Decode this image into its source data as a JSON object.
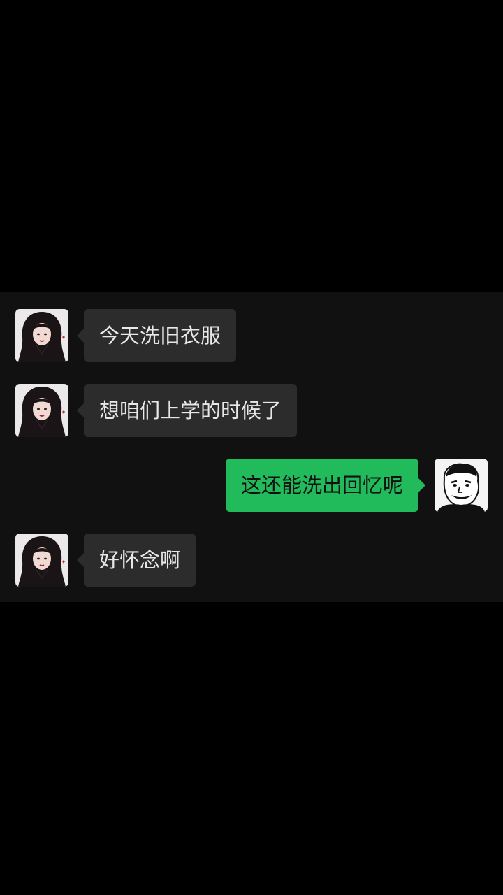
{
  "messages": [
    {
      "side": "incoming",
      "avatar_icon": "girl-avatar-icon",
      "text": "今天洗旧衣服"
    },
    {
      "side": "incoming",
      "avatar_icon": "girl-avatar-icon",
      "text": "想咱们上学的时候了"
    },
    {
      "side": "outgoing",
      "avatar_icon": "meme-face-avatar-icon",
      "text": "这还能洗出回忆呢"
    },
    {
      "side": "incoming",
      "avatar_icon": "girl-avatar-icon",
      "text": "好怀念啊"
    }
  ],
  "colors": {
    "page_background": "#000000",
    "chat_background": "#111111",
    "incoming_bubble": "#2c2c2c",
    "incoming_text": "#e8e8e8",
    "outgoing_bubble": "#22bb5c",
    "outgoing_text": "#111111"
  }
}
